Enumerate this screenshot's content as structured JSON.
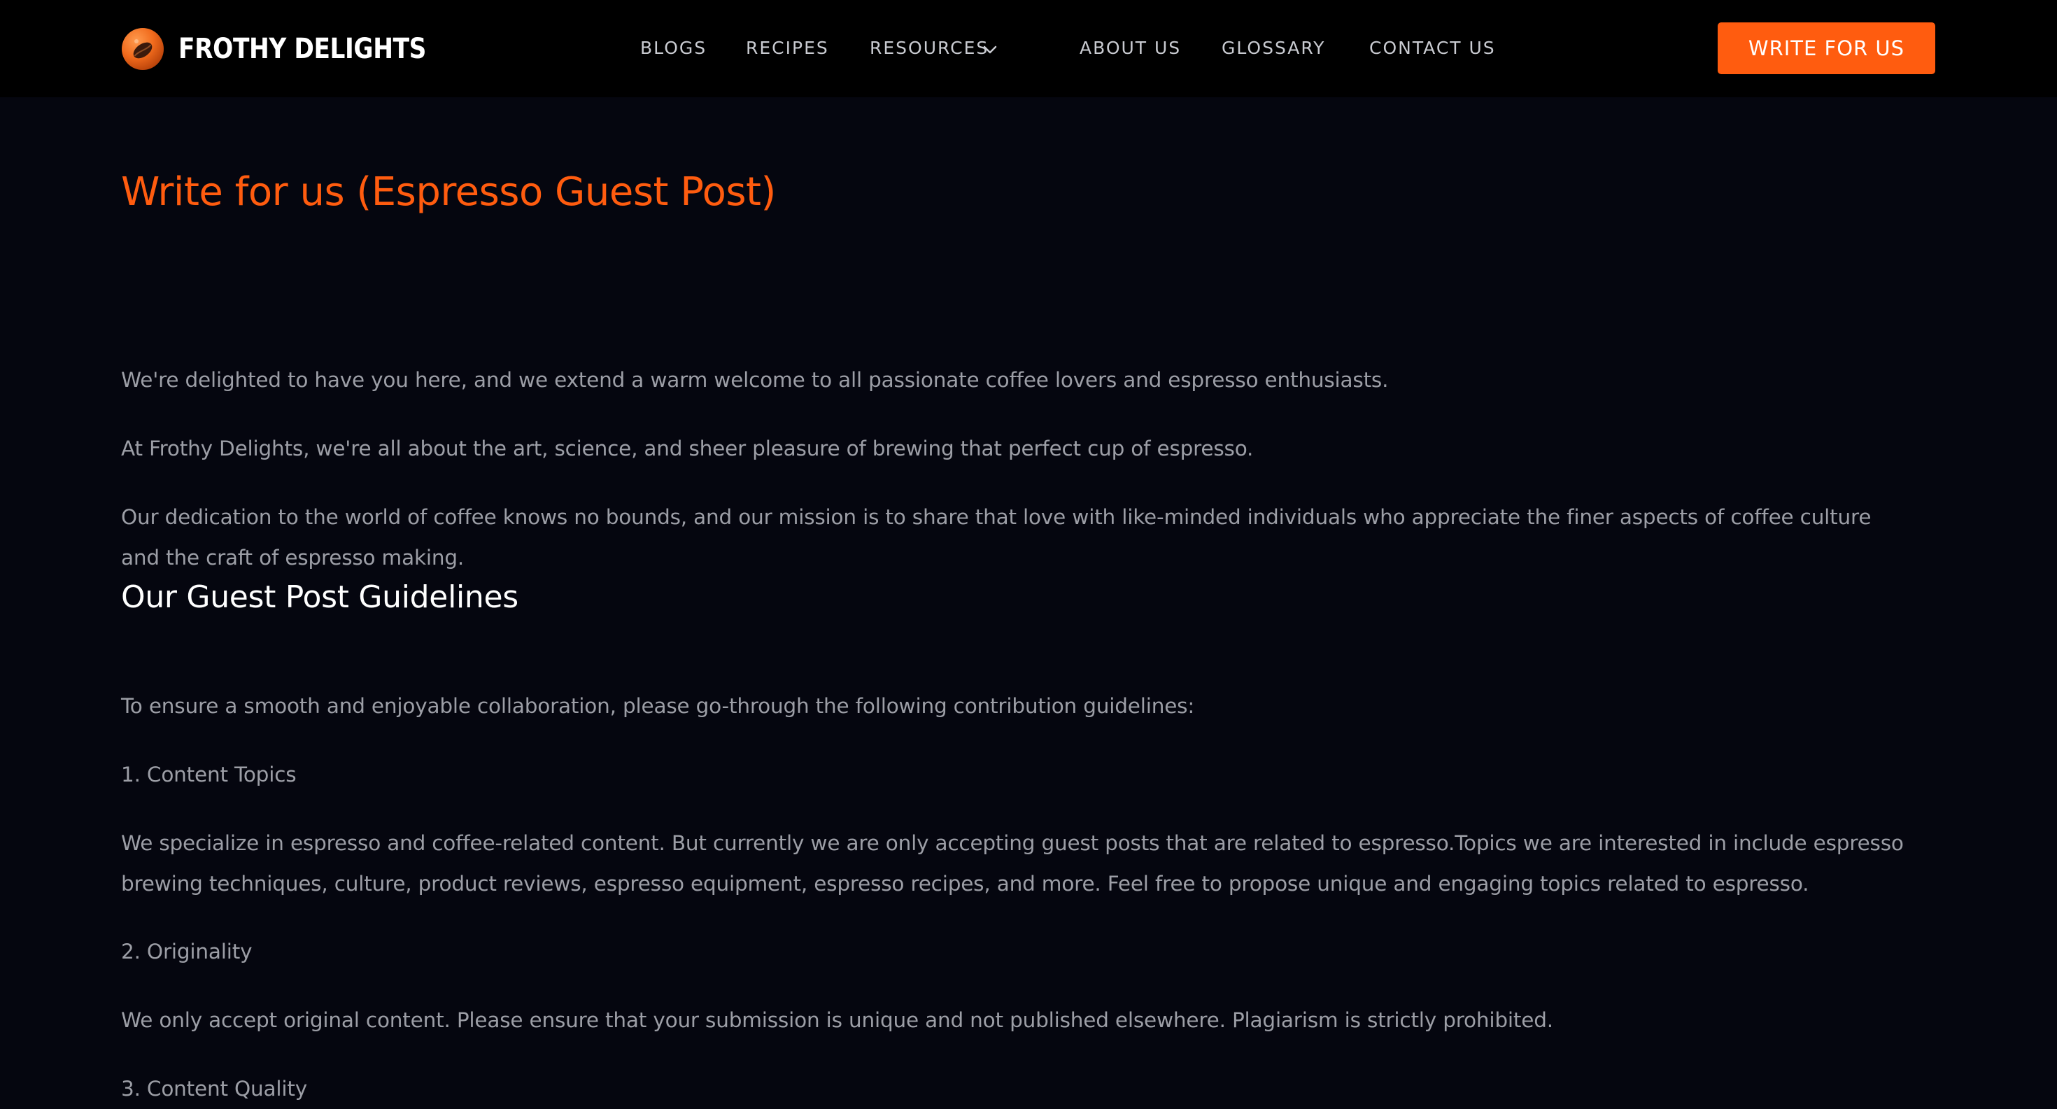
{
  "brand": {
    "name": "FROTHY DELIGHTS",
    "logo_icon": "coffee-bean-icon"
  },
  "nav": {
    "items": [
      "BLOGS",
      "RECIPES",
      "RESOURCES",
      "ABOUT US",
      "GLOSSARY",
      "CONTACT US"
    ],
    "resources_dropdown_icon": "chevron-down-icon"
  },
  "cta": {
    "label": "WRITE FOR US"
  },
  "main": {
    "title": "Write for us (Espresso Guest Post)",
    "intro": [
      "We're delighted to have you here, and we extend a warm welcome to all passionate coffee lovers and espresso enthusiasts.",
      "At Frothy Delights, we're all about the art, science, and sheer pleasure of brewing that perfect cup of espresso.",
      "Our dedication to the world of coffee knows no bounds, and our mission is to share that love with like-minded individuals who appreciate the finer aspects of coffee culture and the craft of espresso making."
    ],
    "section_title": "Our Guest Post Guidelines",
    "guidelines_intro": "To ensure a smooth and enjoyable collaboration, please go-through the following contribution guidelines:",
    "guidelines": [
      {
        "heading": "1. Content Topics",
        "body": "We specialize in espresso and coffee-related content. But currently we are only accepting guest posts that are related to espresso.Topics we are interested in include espresso brewing techniques, culture, product reviews, espresso equipment, espresso recipes, and more. Feel free to propose unique and engaging topics related to espresso."
      },
      {
        "heading": "2. Originality",
        "body": "We only accept original content. Please ensure that your submission is unique and not published elsewhere. Plagiarism is strictly prohibited."
      },
      {
        "heading": "3. Content Quality"
      }
    ]
  },
  "colors": {
    "accent": "#ff5c0f",
    "header_bg": "#000000",
    "page_bg": "#05060f",
    "body_text": "#9c9ea6",
    "heading_text": "#ffffff",
    "nav_text": "#c9cbd1"
  }
}
